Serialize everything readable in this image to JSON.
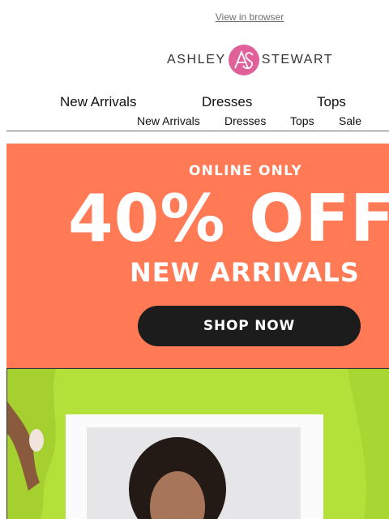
{
  "header": {
    "view_in_browser": "View in browser"
  },
  "brand": {
    "left_word": "ASHLEY",
    "right_word": "STEWART",
    "monogram": "AS",
    "logo_color": "#e0619a"
  },
  "nav_primary": [
    "New Arrivals",
    "Dresses",
    "Tops"
  ],
  "nav_secondary": [
    "New Arrivals",
    "Dresses",
    "Tops",
    "Sale"
  ],
  "promo": {
    "eyebrow": "ONLINE ONLY",
    "headline": "40% OFF",
    "subhead": "NEW ARRIVALS",
    "cta": "SHOP NOW",
    "background": "#ff7a55",
    "cta_background": "#1c1c1c"
  },
  "hero_photo": {
    "background": "#b4e03a"
  }
}
